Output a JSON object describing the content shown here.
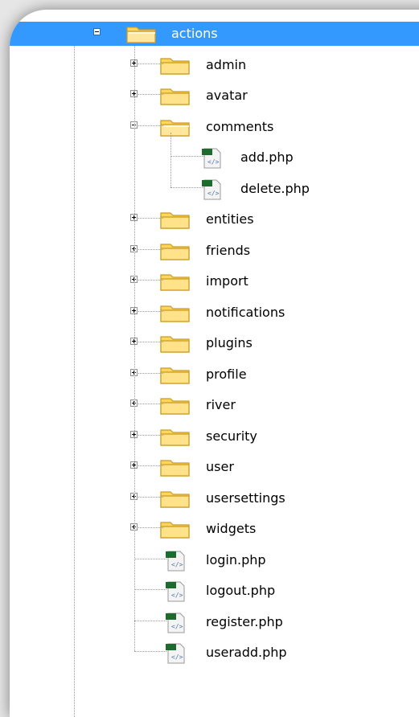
{
  "tree": {
    "root": {
      "label": "actions",
      "icon": "folder-open-icon",
      "expanded": true,
      "selected": true
    },
    "children": [
      {
        "label": "admin",
        "type": "folder",
        "icon": "folder-icon",
        "expanded": false
      },
      {
        "label": "avatar",
        "type": "folder",
        "icon": "folder-icon",
        "expanded": false
      },
      {
        "label": "comments",
        "type": "folder",
        "icon": "folder-icon",
        "expanded": true,
        "children": [
          {
            "label": "add.php",
            "type": "file",
            "icon": "php-file-icon"
          },
          {
            "label": "delete.php",
            "type": "file",
            "icon": "php-file-icon"
          }
        ]
      },
      {
        "label": "entities",
        "type": "folder",
        "icon": "folder-icon",
        "expanded": false
      },
      {
        "label": "friends",
        "type": "folder",
        "icon": "folder-icon",
        "expanded": false
      },
      {
        "label": "import",
        "type": "folder",
        "icon": "folder-icon",
        "expanded": false
      },
      {
        "label": "notifications",
        "type": "folder",
        "icon": "folder-icon",
        "expanded": false
      },
      {
        "label": "plugins",
        "type": "folder",
        "icon": "folder-icon",
        "expanded": false
      },
      {
        "label": "profile",
        "type": "folder",
        "icon": "folder-icon",
        "expanded": false
      },
      {
        "label": "river",
        "type": "folder",
        "icon": "folder-icon",
        "expanded": false
      },
      {
        "label": "security",
        "type": "folder",
        "icon": "folder-icon",
        "expanded": false
      },
      {
        "label": "user",
        "type": "folder",
        "icon": "folder-icon",
        "expanded": false
      },
      {
        "label": "usersettings",
        "type": "folder",
        "icon": "folder-icon",
        "expanded": false
      },
      {
        "label": "widgets",
        "type": "folder",
        "icon": "folder-icon",
        "expanded": false
      },
      {
        "label": "login.php",
        "type": "file",
        "icon": "php-file-icon"
      },
      {
        "label": "logout.php",
        "type": "file",
        "icon": "php-file-icon"
      },
      {
        "label": "register.php",
        "type": "file",
        "icon": "php-file-icon"
      },
      {
        "label": "useradd.php",
        "type": "file",
        "icon": "php-file-icon"
      }
    ]
  },
  "colors": {
    "selection": "#3399ff",
    "folder": "#ffd75e",
    "folder_edge": "#c99a1e",
    "file_badge": "#1e6b2e"
  }
}
